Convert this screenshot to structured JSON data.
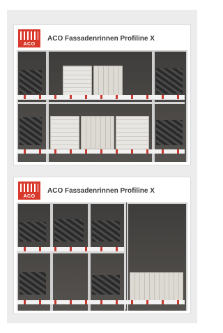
{
  "displays": [
    {
      "brand": "ACO",
      "title": "ACO Fassadenrinnen Profiline X"
    },
    {
      "brand": "ACO",
      "title": "ACO Fassadenrinnen Profiline X"
    }
  ],
  "colors": {
    "brand_red": "#d8392b",
    "panel": "#ececec",
    "title_text": "#3a3a3a"
  }
}
